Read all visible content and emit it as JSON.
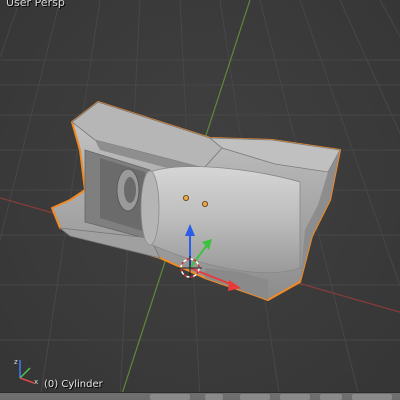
{
  "viewport": {
    "view_label": "User Persp",
    "object_label": "(0) Cylinder"
  },
  "colors": {
    "background": "#393939",
    "grid": "#474747",
    "x_axis": "#8a3b3b",
    "y_axis": "#5d8a3b",
    "selection_outline": "#f08a24",
    "mesh": "#a9a9a9"
  },
  "icons": [
    "3d-cursor-icon",
    "transform-manipulator-icon",
    "axis-orientation-icon"
  ]
}
